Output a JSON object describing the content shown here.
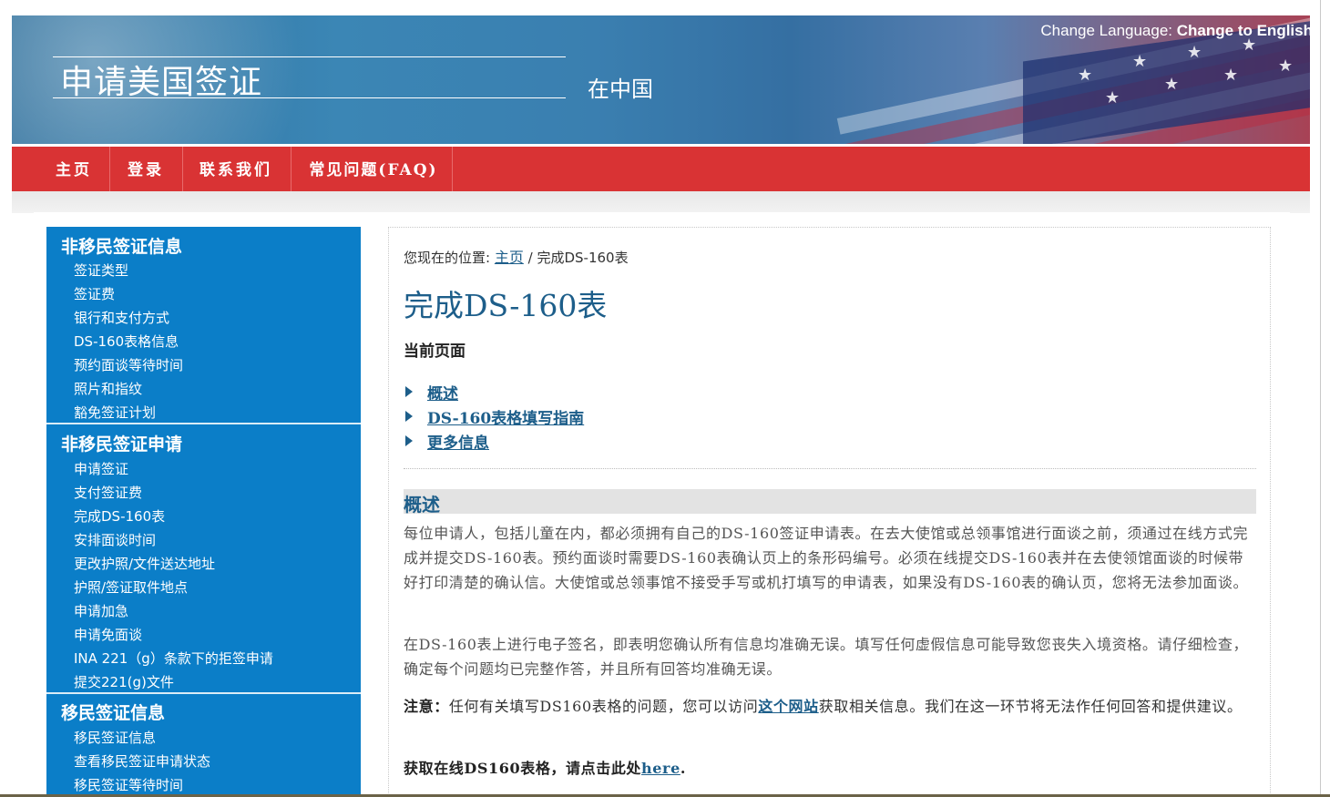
{
  "header": {
    "title": "申请美国签证",
    "subtitle": "在中国",
    "lang_label": "Change Language:",
    "lang_link": "Change to English"
  },
  "nav": [
    "主页",
    "登录",
    "联系我们",
    "常见问题(FAQ)"
  ],
  "sidebar": {
    "sections": [
      {
        "title": "非移民签证信息",
        "items": [
          "签证类型",
          "签证费",
          "银行和支付方式",
          "DS-160表格信息",
          "预约面谈等待时间",
          "照片和指纹",
          "豁免签证计划"
        ]
      },
      {
        "title": "非移民签证申请",
        "items": [
          "申请签证",
          "支付签证费",
          "完成DS-160表",
          "安排面谈时间",
          "更改护照/文件送达地址",
          "护照/签证取件地点",
          "申请加急",
          "申请免面谈",
          "INA 221（g）条款下的拒签申请",
          "提交221(g)文件"
        ]
      },
      {
        "title": "移民签证信息",
        "items": [
          "移民签证信息",
          "查看移民签证申请状态",
          "移民签证等待时间"
        ]
      }
    ]
  },
  "breadcrumb": {
    "prefix": "您现在的位置:",
    "home": "主页",
    "current": "/ 完成DS-160表"
  },
  "page": {
    "title": "完成DS-160表",
    "sub_label": "当前页面",
    "toc": [
      "概述",
      "DS-160表格填写指南",
      "更多信息"
    ],
    "section_title": "概述",
    "para1": "每位申请人，包括儿童在内，都必须拥有自己的DS-160签证申请表。在去大使馆或总领事馆进行面谈之前，须通过在线方式完成并提交DS-160表。预约面谈时需要DS-160表确认页上的条形码编号。必须在线提交DS-160表并在去使领馆面谈的时候带好打印清楚的确认信。大使馆或总领事馆不接受手写或机打填写的申请表，如果没有DS-160表的确认页，您将无法参加面谈。",
    "para2": "在DS-160表上进行电子签名，即表明您确认所有信息均准确无误。填写任何虚假信息可能导致您丧失入境资格。请仔细检查，确定每个问题均已完整作答，并且所有回答均准确无误。",
    "note_label": "注意：",
    "note_before": "任何有关填写DS160表格的问题，您可以访问",
    "note_link": "这个网站",
    "note_after": "获取相关信息。我们在这一环节将无法作任何回答和提供建议。",
    "get_form_text": "获取在线DS160表格，请点击此处",
    "get_form_link": "here",
    "get_form_end": "."
  },
  "colors": {
    "nav": "#d93334",
    "sidebar": "#0b7ec8",
    "link": "#1d5e8a"
  }
}
